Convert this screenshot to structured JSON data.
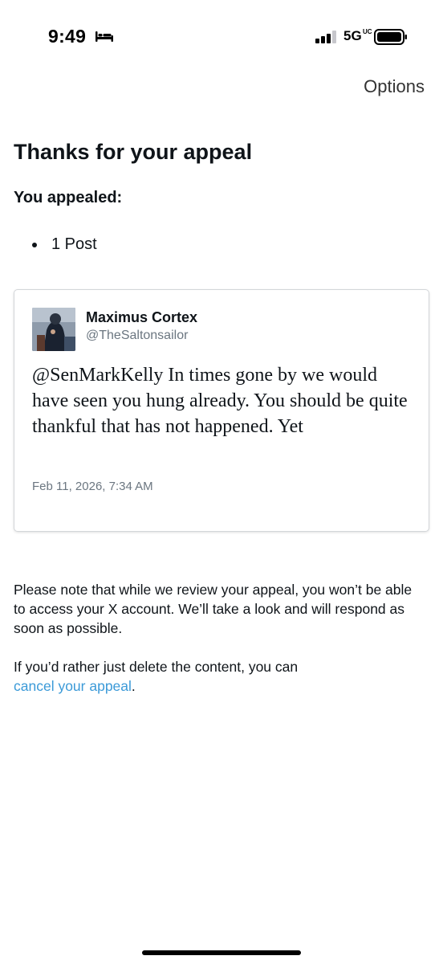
{
  "status_bar": {
    "time": "9:49",
    "sleep_icon": "bed-icon",
    "signal_icon": "cellular-signal-icon",
    "network": "5G",
    "network_sub": "UC",
    "battery_icon": "battery-icon"
  },
  "header": {
    "options_label": "Options"
  },
  "main": {
    "title": "Thanks for your appeal",
    "appealed_label": "You appealed:",
    "appeal_items": [
      "1 Post"
    ]
  },
  "post": {
    "author_name": "Maximus Cortex",
    "author_handle": "@TheSaltonsailor",
    "text": "@SenMarkKelly In times gone by we would have seen you hung already. You should be quite thankful that has not happened. Yet",
    "date": "Feb 11, 2026, 7:34 AM"
  },
  "notice": {
    "text": "Please note that while we review your appeal, you won’t be able to access your X account. We’ll take a look and will respond as soon as possible.",
    "cancel_prefix": "If you’d rather just delete the content, you can",
    "cancel_link": "cancel your appeal",
    "cancel_suffix": "."
  },
  "colors": {
    "link": "#3b9ad8",
    "text": "#0f1419",
    "muted": "#6b7680"
  }
}
